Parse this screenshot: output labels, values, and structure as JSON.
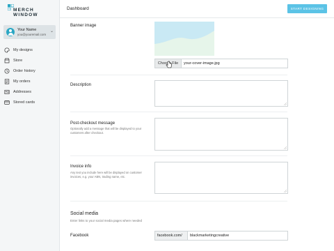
{
  "brand": {
    "logo_line1": "MERCH",
    "logo_line2": "WINDOW"
  },
  "user": {
    "name": "Your Name",
    "email": "you@youremail.com"
  },
  "sidebar": {
    "items": [
      {
        "label": "My designs",
        "icon": "palette-icon"
      },
      {
        "label": "Store",
        "icon": "store-icon"
      },
      {
        "label": "Order history",
        "icon": "history-icon"
      },
      {
        "label": "My orders",
        "icon": "orders-icon"
      },
      {
        "label": "Addresses",
        "icon": "address-icon"
      },
      {
        "label": "Stored cards",
        "icon": "card-icon"
      }
    ]
  },
  "header": {
    "title": "Dashboard",
    "start_label": "START DESIGNING"
  },
  "form": {
    "banner": {
      "label": "Banner image",
      "choose_label": "Choose File",
      "file_name": "your-cover-image.jpg"
    },
    "description": {
      "label": "Description"
    },
    "post_checkout": {
      "label": "Post-checkout message",
      "help": "Optionally add a message that will be displayed to your customers after checkout."
    },
    "invoice": {
      "label": "Invoice info",
      "help": "Any text you include here will be displayed on customer invoices, e.g. your ABN, trading name, etc."
    },
    "social": {
      "title": "Social media",
      "help": "Enter links to your social media pages where needed",
      "facebook": {
        "label": "Facebook",
        "prefix": "facebook.com/",
        "value": "blackmarketingcreative"
      }
    }
  },
  "colors": {
    "accent": "#5bc3e6",
    "brand": "#2aa7c4",
    "sidebar_bg": "#f4f6f7"
  }
}
